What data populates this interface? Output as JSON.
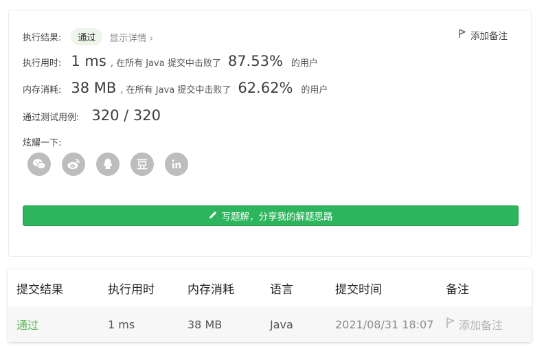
{
  "result": {
    "label": "执行结果:",
    "status": "通过",
    "details_link": "显示详情 ›",
    "add_note": "添加备注"
  },
  "runtime": {
    "label": "执行用时:",
    "value": "1 ms",
    "middle": ", 在所有 Java 提交中击败了",
    "percent": "87.53%",
    "suffix": "的用户"
  },
  "memory": {
    "label": "内存消耗:",
    "value": "38 MB",
    "middle": ", 在所有 Java 提交中击败了",
    "percent": "62.62%",
    "suffix": "的用户"
  },
  "tests": {
    "label": "通过测试用例:",
    "value": "320 / 320"
  },
  "share": {
    "label": "炫耀一下:",
    "icons": [
      "wechat-icon",
      "weibo-icon",
      "qq-icon",
      "douban-icon",
      "linkedin-icon"
    ]
  },
  "solution_button": "写题解，分享我的解题思路",
  "colors": {
    "accent_green": "#2db55d",
    "pass_green": "#5cb85c",
    "pill_bg": "#eef6ea",
    "icon_grey": "#bdbdbd"
  },
  "table": {
    "headers": [
      "提交结果",
      "执行用时",
      "内存消耗",
      "语言",
      "提交时间",
      "备注"
    ],
    "row": {
      "result": "通过",
      "runtime": "1 ms",
      "memory": "38 MB",
      "language": "Java",
      "time": "2021/08/31 18:07",
      "note": "添加备注"
    }
  }
}
